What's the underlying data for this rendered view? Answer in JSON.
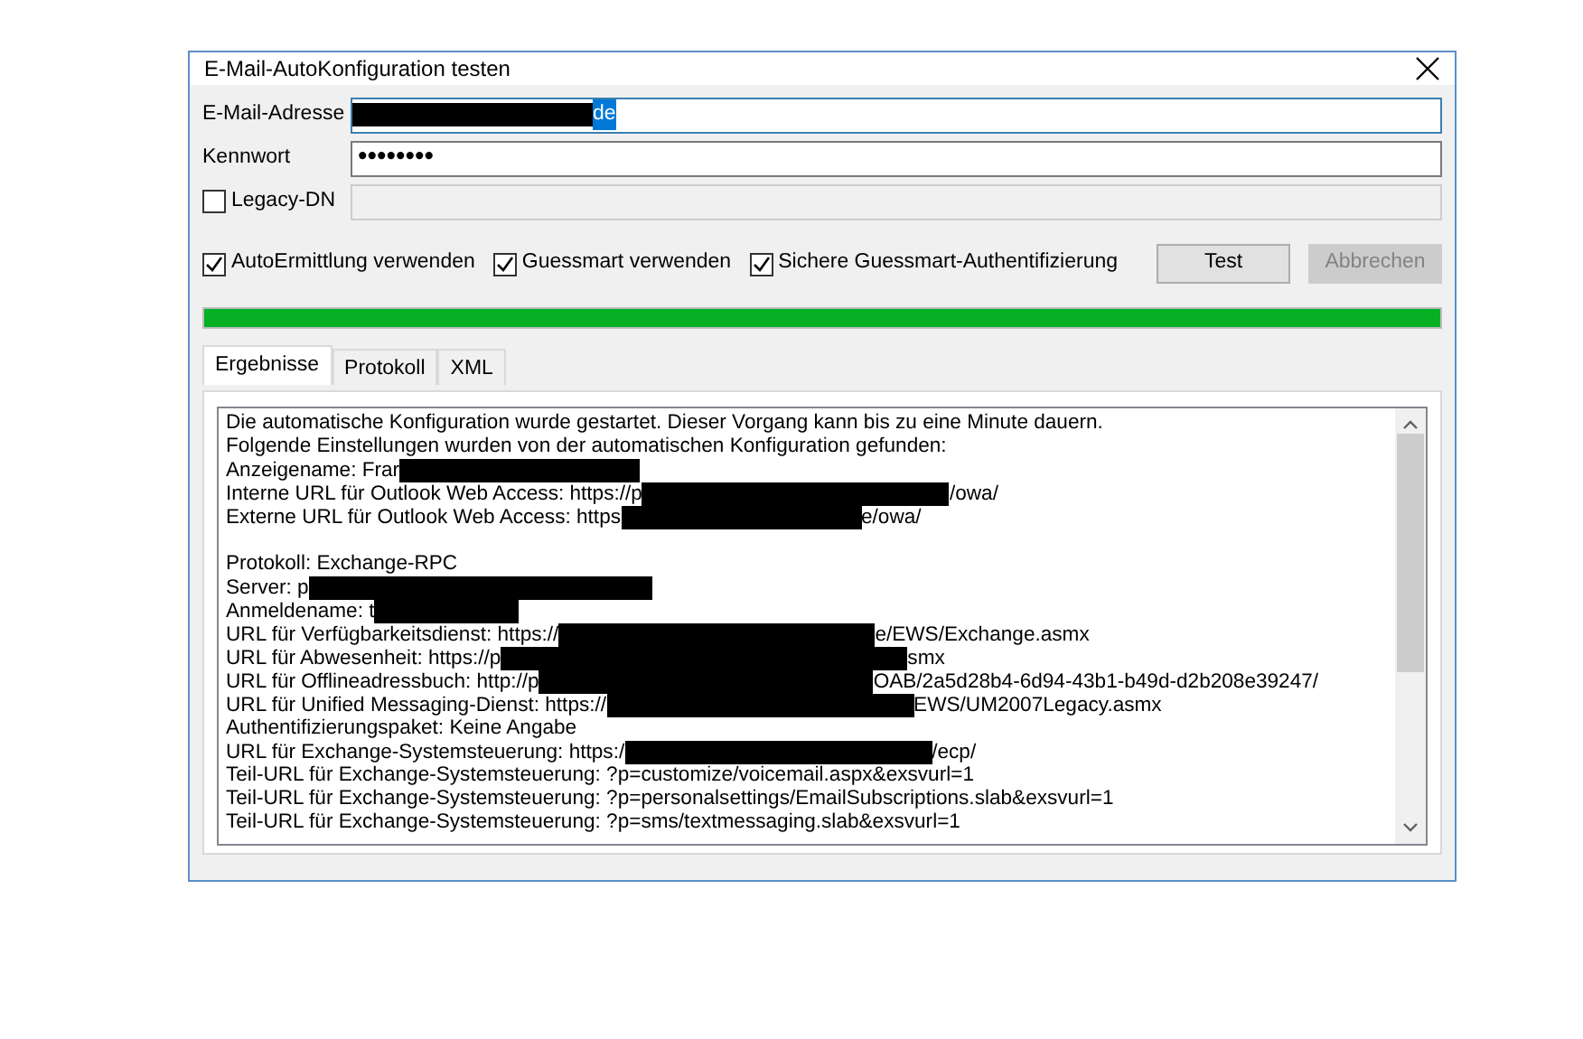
{
  "window": {
    "title": "E-Mail-AutoKonfiguration testen"
  },
  "email": {
    "label": "E-Mail-Adresse",
    "value_hidden": true,
    "value": "de"
  },
  "password": {
    "label": "Kennwort",
    "value": "••••••••"
  },
  "legacy": {
    "label": "Legacy-DN",
    "checked": false,
    "disabled": true
  },
  "options": [
    {
      "label": "AutoErmittlung verwenden",
      "checked": true
    },
    {
      "label": "Guessmart verwenden",
      "checked": true
    },
    {
      "label": "Sichere Guessmart-Authentifizierung",
      "checked": true
    }
  ],
  "buttons": [
    {
      "label": "Test",
      "disabled": false
    },
    {
      "label": "Abbrechen",
      "disabled": true
    }
  ],
  "progress": {
    "level": 1
  },
  "tabs": [
    {
      "label": "Ergebnisse",
      "selected": true
    },
    {
      "label": "Protokoll",
      "selected": false
    },
    {
      "label": "XML",
      "selected": false
    }
  ],
  "results": [
    {
      "parts": [
        {
          "kind": "text",
          "text": "Die automatische Konfiguration wurde gestartet. Dieser Vorgang kann bis zu eine Minute dauern."
        }
      ]
    },
    {
      "parts": [
        {
          "kind": "text",
          "text": "Folgende Einstellungen wurden von der automatischen Konfiguration gefunden:"
        }
      ]
    },
    {
      "parts": [
        {
          "kind": "text",
          "text": "Anzeigename: Frar"
        },
        {
          "kind": "redaction"
        }
      ]
    },
    {
      "parts": [
        {
          "kind": "text",
          "text": "Interne URL für Outlook Web Access: https://p"
        },
        {
          "kind": "redaction"
        },
        {
          "kind": "text",
          "text": "/owa/"
        }
      ]
    },
    {
      "parts": [
        {
          "kind": "text",
          "text": "Externe URL für Outlook Web Access: https"
        },
        {
          "kind": "redaction"
        },
        {
          "kind": "text",
          "text": "e/owa/"
        }
      ]
    },
    {
      "kind": "blank"
    },
    {
      "parts": [
        {
          "kind": "text",
          "text": "Protokoll: Exchange-RPC"
        }
      ]
    },
    {
      "parts": [
        {
          "kind": "text",
          "text": "Server: p"
        },
        {
          "kind": "redaction"
        }
      ]
    },
    {
      "parts": [
        {
          "kind": "text",
          "text": "Anmeldename: t"
        },
        {
          "kind": "redaction"
        }
      ]
    },
    {
      "parts": [
        {
          "kind": "text",
          "text": "URL für Verfügbarkeitsdienst: https://"
        },
        {
          "kind": "redaction"
        },
        {
          "kind": "text",
          "text": "e/EWS/Exchange.asmx"
        }
      ]
    },
    {
      "parts": [
        {
          "kind": "text",
          "text": "URL für Abwesenheit: https://p"
        },
        {
          "kind": "redaction"
        },
        {
          "kind": "text",
          "text": "smx"
        }
      ]
    },
    {
      "parts": [
        {
          "kind": "text",
          "text": "URL für Offlineadressbuch: http://p"
        },
        {
          "kind": "redaction"
        },
        {
          "kind": "text",
          "text": "OAB/2a5d28b4-6d94-43b1-b49d-d2b208e39247/"
        }
      ]
    },
    {
      "parts": [
        {
          "kind": "text",
          "text": "URL für Unified Messaging-Dienst: https://"
        },
        {
          "kind": "redaction"
        },
        {
          "kind": "text",
          "text": "EWS/UM2007Legacy.asmx"
        }
      ]
    },
    {
      "parts": [
        {
          "kind": "text",
          "text": "Authentifizierungspaket: Keine Angabe"
        }
      ]
    },
    {
      "parts": [
        {
          "kind": "text",
          "text": "URL für Exchange-Systemsteuerung: https:/"
        },
        {
          "kind": "redaction"
        },
        {
          "kind": "text",
          "text": "/ecp/"
        }
      ]
    },
    {
      "parts": [
        {
          "kind": "text",
          "text": "Teil-URL für Exchange-Systemsteuerung: ?p=customize/voicemail.aspx&exsvurl=1"
        }
      ]
    },
    {
      "parts": [
        {
          "kind": "text",
          "text": "Teil-URL für Exchange-Systemsteuerung: ?p=personalsettings/EmailSubscriptions.slab&exsvurl=1"
        }
      ]
    },
    {
      "parts": [
        {
          "kind": "text",
          "text": "Teil-URL für Exchange-Systemsteuerung: ?p=sms/textmessaging.slab&exsvurl=1"
        }
      ]
    }
  ]
}
